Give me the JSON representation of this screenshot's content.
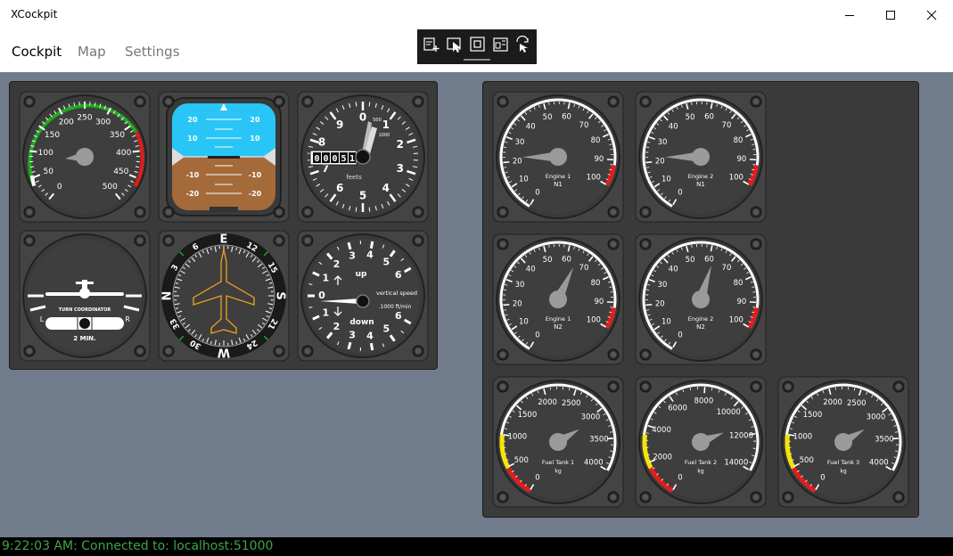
{
  "window": {
    "title": "XCockpit"
  },
  "nav": {
    "tabs": [
      {
        "label": "Cockpit",
        "selected": true
      },
      {
        "label": "Map",
        "selected": false
      },
      {
        "label": "Settings",
        "selected": false
      }
    ]
  },
  "toolbar": {
    "icons": [
      "add-instrument-icon",
      "select-icon",
      "fit-icon",
      "properties-icon",
      "switch-icon"
    ]
  },
  "colors": {
    "workspace": "#707c8b",
    "panel": "#3a3a3a",
    "sky": "#29c5f6",
    "ground": "#a56a3a",
    "needle": "#9a9a9a",
    "warning_red": "#e21b1b",
    "caution_yellow": "#f5e400",
    "safe_green": "#1faa1f",
    "status_text": "#3ea447",
    "heading_airplane": "#f0a020"
  },
  "instruments": {
    "airspeed": {
      "labels": [
        "0",
        "50",
        "100",
        "150",
        "200",
        "250",
        "300",
        "350",
        "400",
        "450",
        "500"
      ],
      "value": 80
    },
    "attitude": {
      "pitch_labels": [
        "20",
        "10",
        "-10",
        "-20"
      ]
    },
    "altimeter": {
      "labels": [
        "0",
        "1",
        "2",
        "3",
        "4",
        "5",
        "6",
        "7",
        "8",
        "9"
      ],
      "unit": "feets",
      "counter": [
        "0",
        "0",
        "0",
        "5",
        "1"
      ],
      "small_mark": "500",
      "small_mark2": "1000"
    },
    "turn_coordinator": {
      "title": "TURN COORDINATOR",
      "left": "L",
      "right": "R",
      "note": "2 MIN."
    },
    "heading": {
      "cardinals": [
        "N",
        "E",
        "S",
        "W"
      ],
      "numbers": [
        "3",
        "6",
        "12",
        "15",
        "21",
        "24",
        "30",
        "33"
      ],
      "heading_deg": 0
    },
    "vertical_speed": {
      "up": "up",
      "down": "down",
      "title": "vertical speed",
      "unit": ".1000 ft/min",
      "up_labels": [
        "1",
        "2",
        "3",
        "4",
        "5",
        "6"
      ],
      "down_labels": [
        "1",
        "2",
        "3",
        "4",
        "5",
        "6"
      ],
      "zero": "0"
    },
    "engine1_n1": {
      "label": "Engine 1",
      "sub": "N1",
      "ticks": [
        "0",
        "10",
        "20",
        "30",
        "40",
        "50",
        "60",
        "70",
        "80",
        "90",
        "100"
      ],
      "value": 22
    },
    "engine2_n1": {
      "label": "Engine 2",
      "sub": "N1",
      "ticks": [
        "0",
        "10",
        "20",
        "30",
        "40",
        "50",
        "60",
        "70",
        "80",
        "90",
        "100"
      ],
      "value": 22
    },
    "engine1_n2": {
      "label": "Engine 1",
      "sub": "N2",
      "ticks": [
        "0",
        "10",
        "20",
        "30",
        "40",
        "50",
        "60",
        "70",
        "80",
        "90",
        "100"
      ],
      "value": 65
    },
    "engine2_n2": {
      "label": "Engine 2",
      "sub": "N2",
      "ticks": [
        "0",
        "10",
        "20",
        "30",
        "40",
        "50",
        "60",
        "70",
        "80",
        "90",
        "100"
      ],
      "value": 62
    },
    "fuel_tank1": {
      "label": "Fuel Tank 1",
      "unit": "kg",
      "ticks": [
        "0",
        "500",
        "1000",
        "1500",
        "2000",
        "2500",
        "3000",
        "3500",
        "4000"
      ],
      "max": 4000,
      "value": 3100
    },
    "fuel_tank2": {
      "label": "Fuel Tank 2",
      "unit": "kg",
      "ticks": [
        "0",
        "2000",
        "4000",
        "6000",
        "8000",
        "10000",
        "12000",
        "14000"
      ],
      "max": 14000,
      "value": 11300
    },
    "fuel_tank3": {
      "label": "Fuel Tank 3",
      "unit": "kg",
      "ticks": [
        "0",
        "500",
        "1000",
        "1500",
        "2000",
        "2500",
        "3000",
        "3500",
        "4000"
      ],
      "max": 4000,
      "value": 3100
    }
  },
  "status": {
    "text": "9:22:03 AM: Connected to: localhost:51000"
  }
}
